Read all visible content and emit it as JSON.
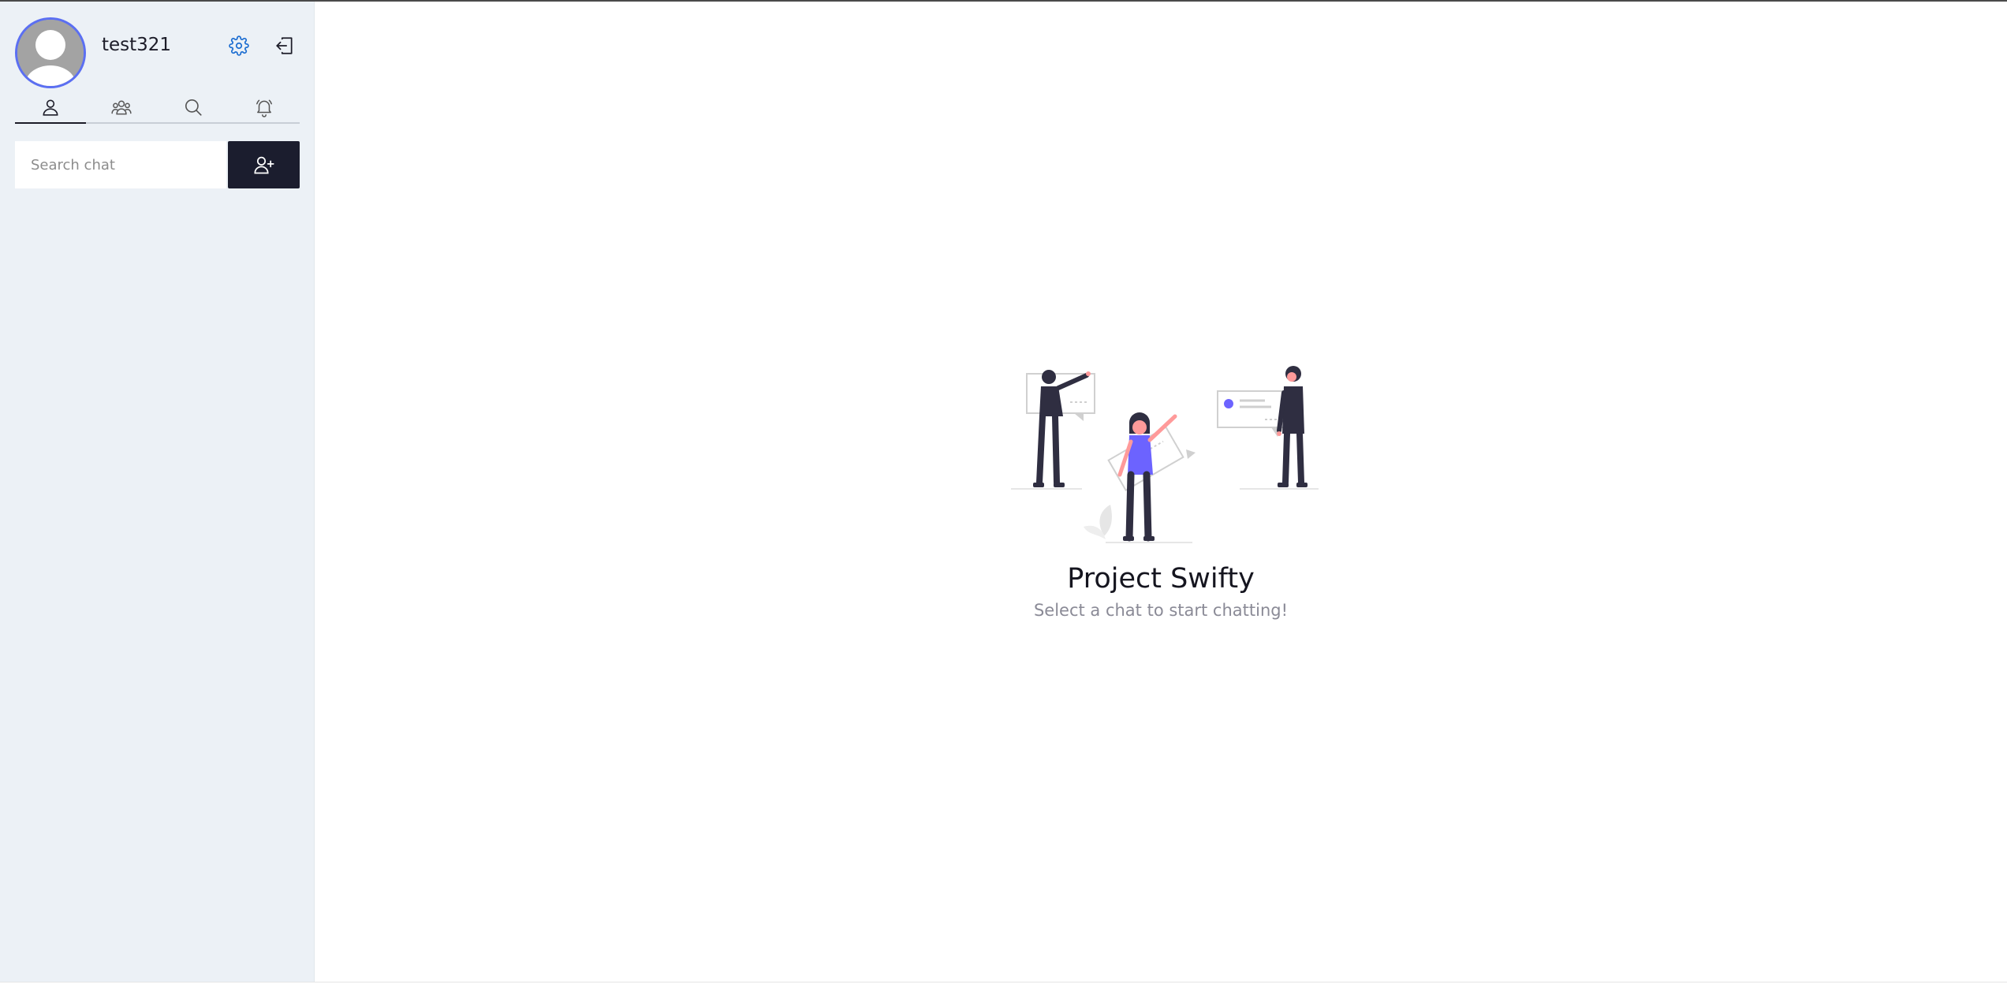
{
  "profile": {
    "username": "test321",
    "avatar_icon": "user-avatar-placeholder",
    "settings_icon": "gear-icon",
    "logout_icon": "logout-icon"
  },
  "tabs": [
    {
      "name": "chats",
      "icon": "user-icon",
      "active": true
    },
    {
      "name": "groups",
      "icon": "group-icon",
      "active": false
    },
    {
      "name": "search",
      "icon": "search-icon",
      "active": false
    },
    {
      "name": "notifications",
      "icon": "bell-icon",
      "active": false
    }
  ],
  "search": {
    "placeholder": "Search chat",
    "value": "",
    "add_icon": "add-user-icon"
  },
  "empty_state": {
    "title": "Project Swifty",
    "subtitle": "Select a chat to start chatting!"
  },
  "colors": {
    "sidebar_bg": "#ecf1f6",
    "accent": "#5b6ff2",
    "dark_button": "#1b1d2e",
    "settings_icon": "#1f6fd1",
    "illustration_accent": "#6c63ff",
    "illustration_pink": "#ff9a9a"
  }
}
